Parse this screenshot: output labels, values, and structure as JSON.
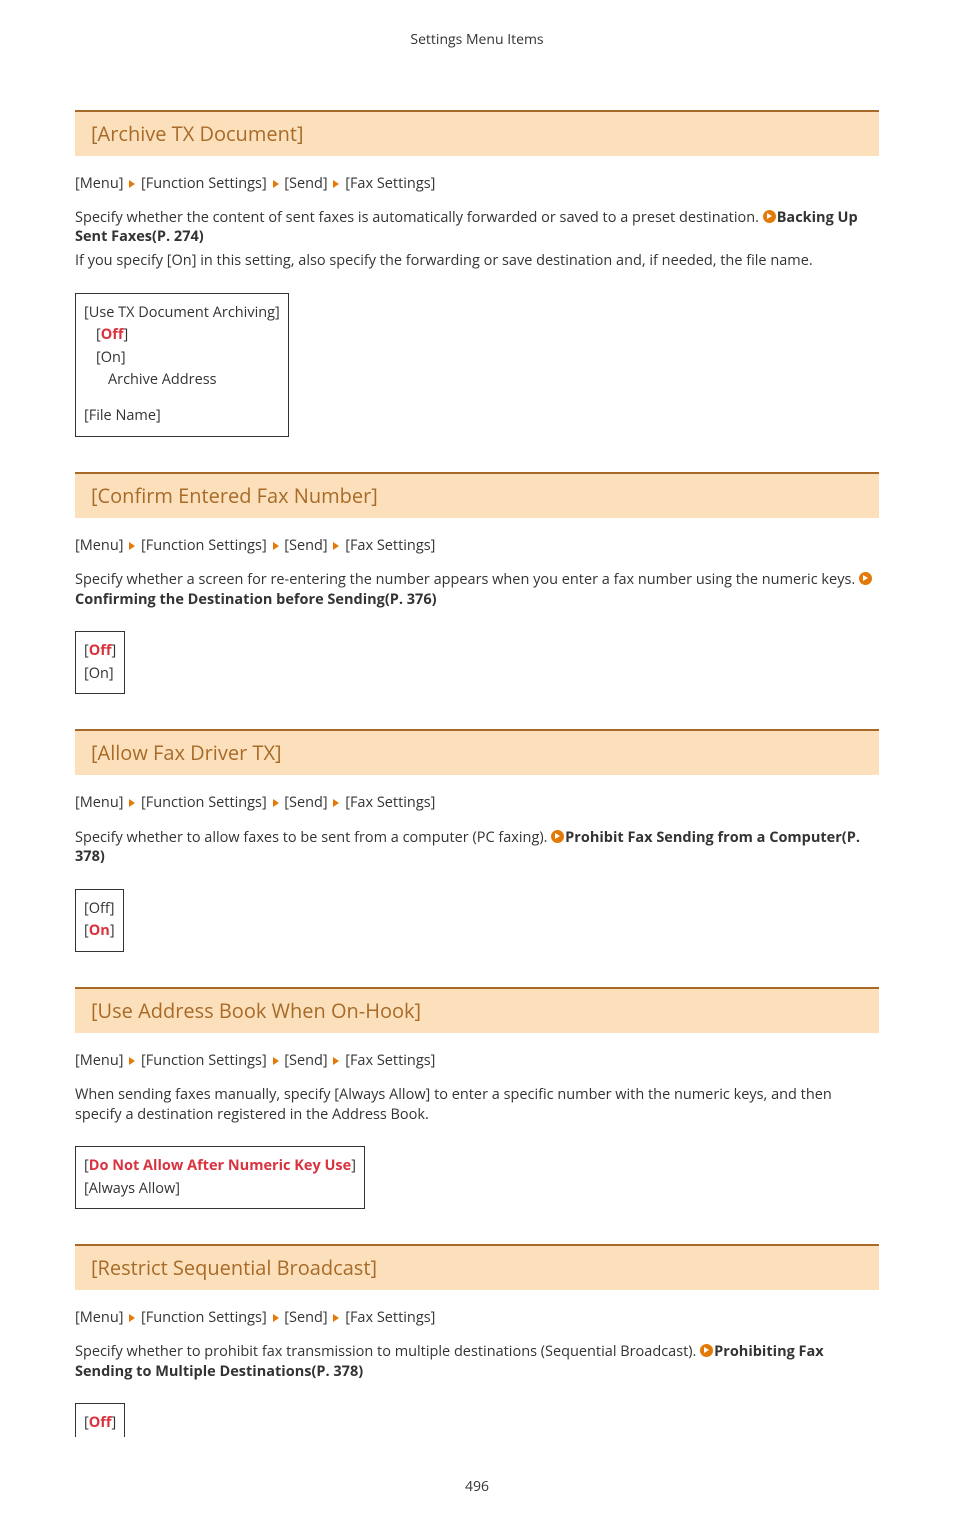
{
  "header": {
    "title": "Settings Menu Items"
  },
  "breadcrumb": {
    "parts": {
      "menu": "[Menu]",
      "fs": "[Function Settings]",
      "send": "[Send]",
      "fax": "[Fax Settings]"
    }
  },
  "sections": {
    "archive": {
      "title": "[Archive TX Document]",
      "desc_a": "Specify whether the content of sent faxes is automatically forwarded or saved to a preset destination. ",
      "link": "Backing Up Sent Faxes(P. 274)",
      "desc_b": "If you specify [On] in this setting, also specify the forwarding or save destination and, if needed, the file name.",
      "opts": {
        "l1": "[Use TX Document Archiving]",
        "o_off_l": "[",
        "o_off_mid": "Off",
        "o_off_r": "]",
        "on": "[On]",
        "addr": "Archive Address",
        "fn": "[File Name]"
      }
    },
    "confirm": {
      "title": "[Confirm Entered Fax Number]",
      "desc_a": "Specify whether a screen for re-entering the number appears when you enter a fax number using the numeric keys. ",
      "link": "Confirming the Destination before Sending(P. 376)",
      "opts": {
        "off_l": "[",
        "off_mid": "Off",
        "off_r": "]",
        "on": "[On]"
      }
    },
    "allow": {
      "title": "[Allow Fax Driver TX]",
      "desc_a": "Specify whether to allow faxes to be sent from a computer (PC faxing). ",
      "link": "Prohibit Fax Sending from a Computer(P. 378)",
      "opts": {
        "off": "[Off]",
        "on_l": "[",
        "on_mid": "On",
        "on_r": "]"
      }
    },
    "onhook": {
      "title": "[Use Address Book When On-Hook]",
      "desc": "When sending faxes manually, specify [Always Allow] to enter a specific number with the numeric keys, and then specify a destination registered in the Address Book.",
      "opts": {
        "d_l": "[",
        "d_mid": "Do Not Allow After Numeric Key Use",
        "d_r": "]",
        "allow": "[Always Allow]"
      }
    },
    "restrict": {
      "title": "[Restrict Sequential Broadcast]",
      "desc_a": "Specify whether to prohibit fax transmission to multiple destinations (Sequential Broadcast). ",
      "link": "Prohibiting Fax Sending to Multiple Destinations(P. 378)",
      "opts": {
        "off_l": "[",
        "off_mid": "Off",
        "off_r": "]"
      }
    }
  },
  "pagenum": "496"
}
